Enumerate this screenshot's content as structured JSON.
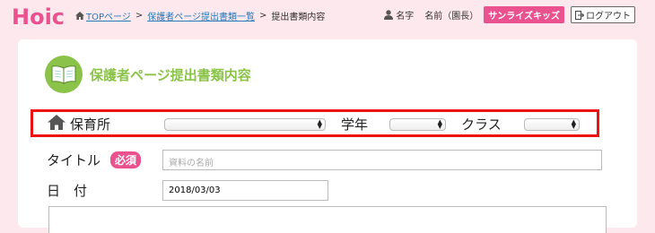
{
  "header": {
    "logo_text": "Hoic",
    "breadcrumb": {
      "top": "TOPページ",
      "list": "保護者ページ提出書類一覧",
      "current": "提出書類内容",
      "separator": ">"
    },
    "user": {
      "name_label": "名字",
      "role_label": "名前（園長）",
      "school": "サンライズキッズ",
      "logout": "ログアウト"
    }
  },
  "page": {
    "title": "保護者ページ提出書類内容",
    "accent_color": "#8bc34a"
  },
  "filter": {
    "nursery_label": "保育所",
    "grade_label": "学年",
    "class_label": "クラス",
    "nursery_value": "",
    "grade_value": "",
    "class_value": ""
  },
  "form": {
    "title_label": "タイトル",
    "required_badge": "必須",
    "title_placeholder": "資料の名前",
    "date_label": "日　付",
    "date_value": "2018/03/03"
  },
  "colors": {
    "background": "#fde8ee",
    "pink": "#e9528f",
    "highlight": "#ee1111",
    "link": "#2a7ab8"
  }
}
